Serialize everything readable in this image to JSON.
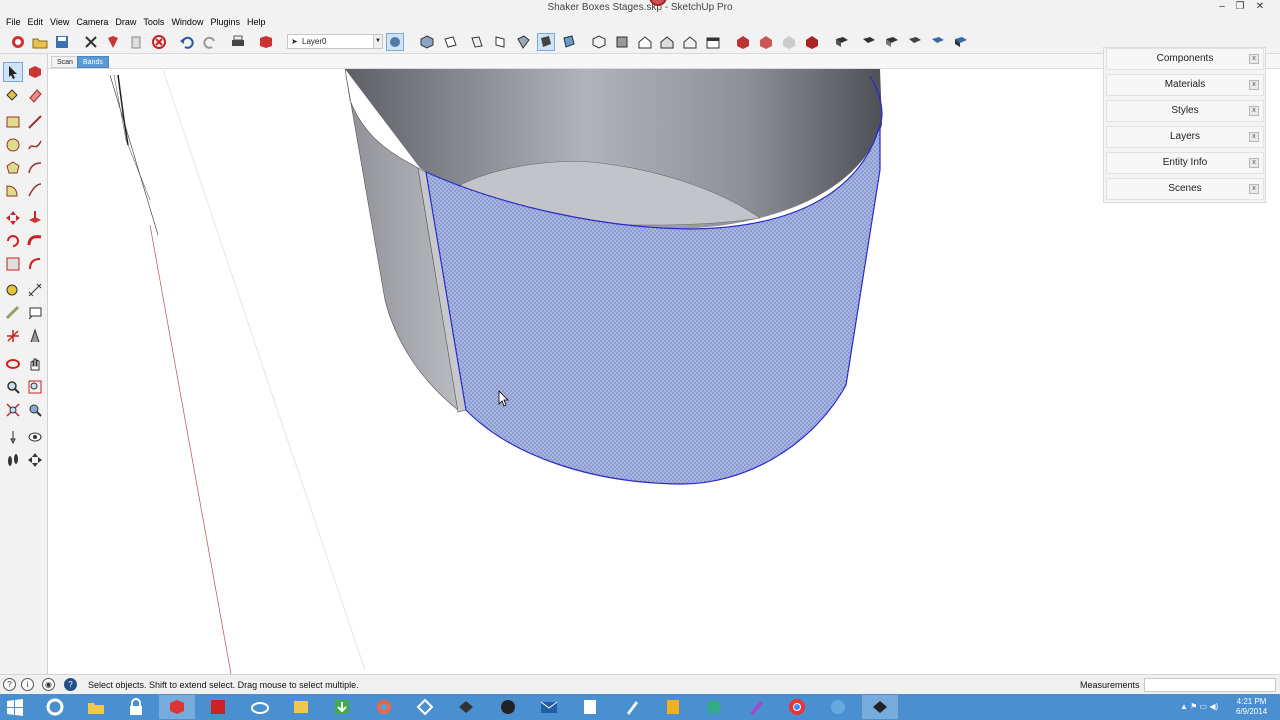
{
  "window": {
    "title": "Shaker Boxes Stages.skp - SketchUp Pro",
    "minimize": "–",
    "restore": "❐",
    "close": "✕"
  },
  "menu": [
    "File",
    "Edit",
    "View",
    "Camera",
    "Draw",
    "Tools",
    "Window",
    "Plugins",
    "Help"
  ],
  "toolbar": {
    "layer_value": "Layer0",
    "icons": [
      "getting-started",
      "open",
      "save",
      "cut",
      "copy",
      "paste",
      "erase",
      "undo",
      "redo",
      "print",
      "model-info",
      "layer-pointer",
      "layer-manager",
      "iso-view",
      "top-view",
      "front-view",
      "right-view",
      "back-view",
      "left-view",
      "xray",
      "wireframe",
      "hidden-line",
      "shaded",
      "shaded-textures",
      "monochrome",
      "section-plane",
      "section-display",
      "warehouse-get",
      "warehouse-share",
      "components-share",
      "extension-warehouse",
      "sandbox-1",
      "sandbox-2",
      "sandbox-3",
      "sandbox-4",
      "sandbox-5",
      "sandbox-6",
      "sandbox-7",
      "sandbox-8"
    ]
  },
  "scene_tabs": [
    "Scan",
    "Bands"
  ],
  "scene_active": 1,
  "tray": {
    "panels": [
      "Components",
      "Materials",
      "Styles",
      "Layers",
      "Entity Info",
      "Scenes"
    ],
    "close": "x"
  },
  "status": {
    "message": "Select objects. Shift to extend select. Drag mouse to select multiple.",
    "measurements_label": "Measurements",
    "measurements_value": "",
    "icons": [
      "?",
      "i",
      "◉",
      "?"
    ]
  },
  "taskbar": {
    "apps": [
      "ie",
      "explorer",
      "lock",
      "sketchup",
      "acrobat",
      "skydrive",
      "photos",
      "download",
      "chrome-color",
      "network",
      "sketchup-alt",
      "hp",
      "mail",
      "onenote",
      "notes",
      "office",
      "ie-alt",
      "pencil",
      "chrome",
      "ie-2",
      "sketchup-layout"
    ],
    "time": "4:21 PM",
    "date": "6/9/2014"
  },
  "colors": {
    "accent": "#5b9bd5",
    "selection": "#3030c0",
    "taskbar": "#4a8fd0"
  }
}
